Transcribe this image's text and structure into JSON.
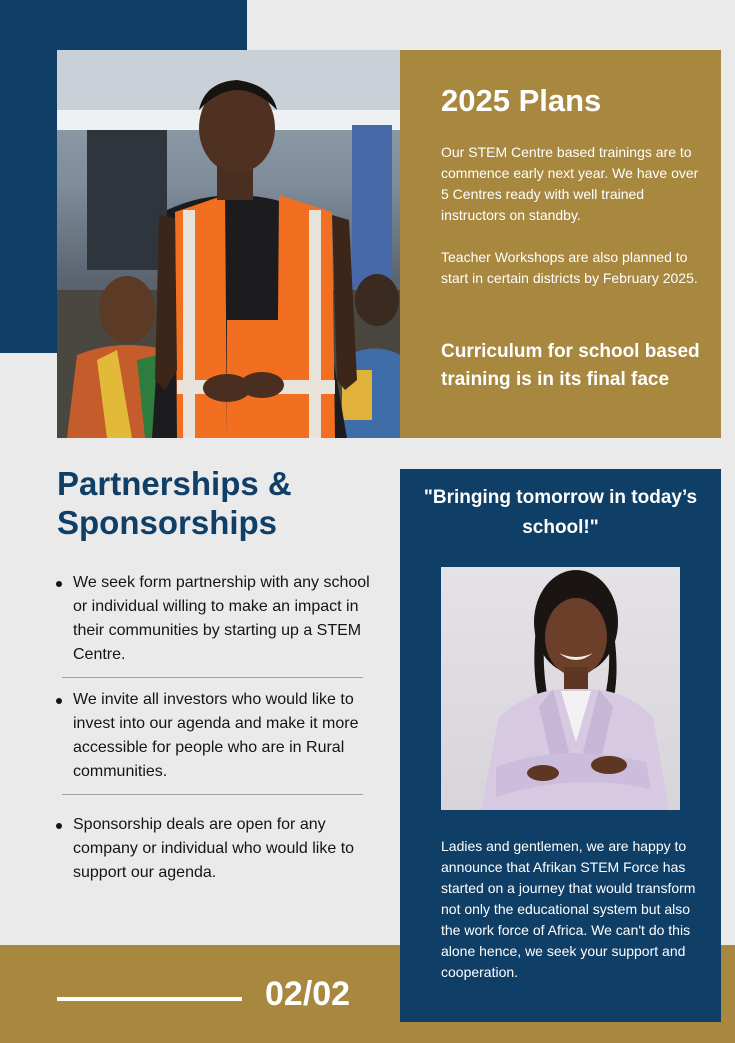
{
  "plans": {
    "title": "2025 Plans",
    "paragraph_1": "Our STEM Centre based trainings are to commence early next year. We have over 5 Centres ready with well trained instructors on standby.",
    "paragraph_2": "Teacher Workshops are also planned to start in certain districts by February 2025.",
    "highlight": "Curriculum for school based training is in its final face"
  },
  "partnerships": {
    "heading": "Partnerships & Sponsorships",
    "items": [
      "We seek form partnership with any school or individual willing to make an impact in their communities by starting up a STEM Centre.",
      "We invite all investors who would like to invest into our agenda and make it more accessible for people who are in Rural communities.",
      "Sponsorship deals are open for any company or individual who would like to support our agenda."
    ]
  },
  "quote": {
    "text": "\"Bringing tomorrow in today’s school!\"",
    "announcement": "Ladies and gentlemen, we are happy to announce that Afrikan STEM Force has started on a journey that would transform not only the educational system but also the work force of Africa. We can't do this alone hence, we seek your support and cooperation."
  },
  "footer": {
    "page_number": "02/02"
  },
  "colors": {
    "navy": "#0f3e67",
    "gold": "#a8873f",
    "background": "#ebeaea"
  }
}
